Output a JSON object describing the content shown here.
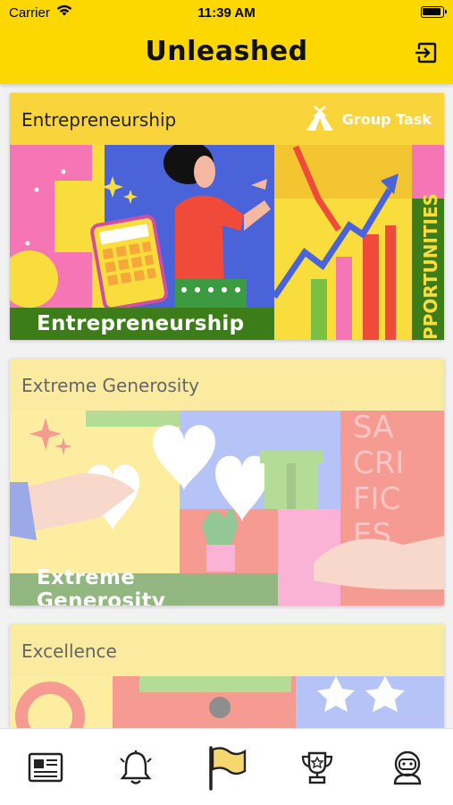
{
  "status_bar": {
    "carrier": "Carrier",
    "time": "11:39 AM"
  },
  "header": {
    "title": "Unleashed",
    "logout_icon": "logout-icon"
  },
  "cards": [
    {
      "title": "Entrepreneurship",
      "badge_label": "Group Task",
      "badge_icon": "tent-icon",
      "image_label": "Entrepreneurship",
      "image_side_text": "PPORTUNITIES",
      "state": "active"
    },
    {
      "title": "Extreme Generosity",
      "image_label": "Extreme Generosity",
      "image_side_text": [
        "SA",
        "CRI",
        "FIC",
        "ES"
      ],
      "state": "faded"
    },
    {
      "title": "Excellence",
      "state": "faded"
    }
  ],
  "tabs": [
    {
      "icon": "newspaper-icon"
    },
    {
      "icon": "bell-icon"
    },
    {
      "icon": "flag-icon",
      "selected": true
    },
    {
      "icon": "trophy-icon"
    },
    {
      "icon": "profile-icon"
    }
  ],
  "colors": {
    "header": "#fcd800",
    "card_header_active": "#f9d43a",
    "card_header_faded": "#faeba0"
  }
}
